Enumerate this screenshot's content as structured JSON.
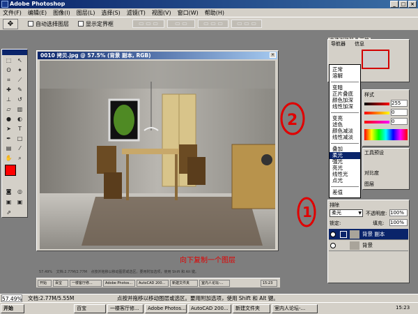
{
  "app": {
    "title": "Adobe Photoshop"
  },
  "menu": [
    "文件(F)",
    "编辑(E)",
    "图像(I)",
    "图层(L)",
    "选择(S)",
    "滤镜(T)",
    "视图(V)",
    "窗口(W)",
    "帮助(H)"
  ],
  "options_bar": {
    "auto_select_layer": "自动选择图层",
    "show_bounding_box": "显示定界框"
  },
  "palette_well": {
    "tabs": [
      "文件浏览器",
      "画笔"
    ]
  },
  "document": {
    "title": "0010 拷贝.jpg @ 57.5% (背景 副本, RGB)",
    "status_zoom": "57.49%",
    "status_doc": "文档:2.77M/2.77M",
    "status_hint": "点按并拖移以移动图层或选区。要用附加选项，使用 Shift 和 Alt 键。"
  },
  "navigator": {
    "tabs": [
      "导航器",
      "信息"
    ]
  },
  "color_panel": {
    "title": "样式",
    "values": [
      "255",
      "0",
      "0"
    ]
  },
  "blend_menu": {
    "groups": [
      [
        "正常",
        "溶解"
      ],
      [
        "变暗",
        "正片叠底",
        "颜色加深",
        "线性加深"
      ],
      [
        "变亮",
        "滤色",
        "颜色减淡",
        "线性减淡"
      ],
      [
        "叠加",
        "柔光",
        "强光",
        "亮光",
        "线性光",
        "点光"
      ],
      [
        "差值",
        "排除"
      ]
    ],
    "partial": [
      "路径",
      "工具预设",
      "对比度",
      "图层"
    ],
    "selected": "柔光"
  },
  "layers_panel": {
    "mode_value": "柔光",
    "opacity_label": "不透明度:",
    "opacity_value": "100%",
    "lock_label": "锁定:",
    "fill_label": "填充:",
    "fill_value": "100%",
    "layers": [
      {
        "name": "背景 副本",
        "selected": true
      },
      {
        "name": "背景",
        "selected": false
      }
    ]
  },
  "annotations": {
    "step1": "1",
    "step2": "2",
    "copy_down": "向下复制一个图层"
  },
  "inner_taskbar": [
    "开始",
    "百宝",
    "一楼客厅修...",
    "Adobe Photos...",
    "AutoCAD 200...",
    "新建文件夹",
    "室内人论坛-...",
    "15:23"
  ],
  "status_bar": {
    "zoom": "57.49%",
    "doc": "文档:2.77M/5.55M",
    "hint": "点按并拖移以移动图层或选区。要用附加选项，使用 Shift 和 Alt 键。"
  },
  "taskbar": {
    "start": "开始",
    "items": [
      "百宝",
      "一楼客厅修...",
      "Adobe Photos...",
      "AutoCAD 200...",
      "新建文件夹",
      "室内人论坛-..."
    ],
    "clock": "15:23"
  },
  "colors": {
    "foreground": "#ff0000",
    "background": "#ffffff",
    "annotation": "#e00000",
    "selection": "#0a246a"
  }
}
